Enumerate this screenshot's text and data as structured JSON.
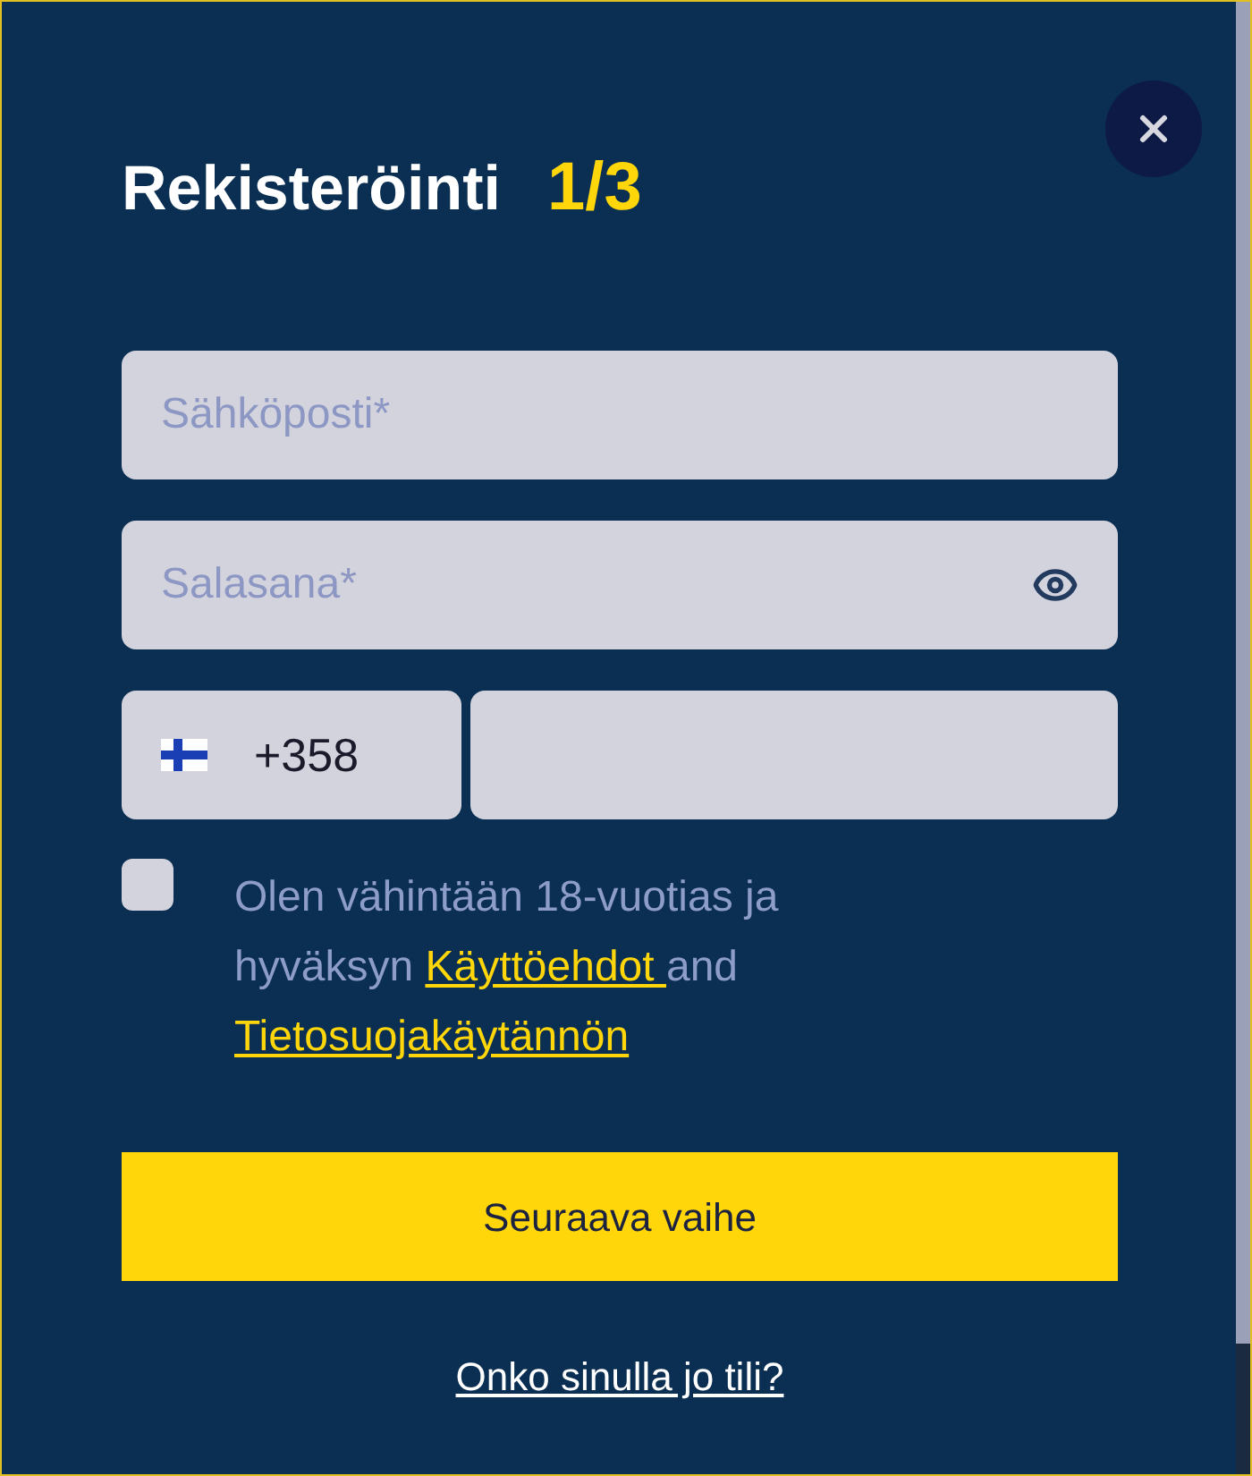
{
  "dialog": {
    "title": "Rekisteröinti",
    "step": "1/3"
  },
  "fields": [
    {
      "kind": "email",
      "placeholder": "Sähköposti*"
    },
    {
      "kind": "password",
      "placeholder": "Salasana*"
    }
  ],
  "phone": {
    "country_code": "+358"
  },
  "consent": {
    "checked": false,
    "text_before": "Olen vähintään 18-vuotias ja hyväksyn ",
    "terms_link": "Käyttöehdot ",
    "between": "and ",
    "privacy_link": "Tietosuojakäytännön"
  },
  "primary_button": "Seuraava vaihe",
  "login_link": "Onko sinulla jo tili?"
}
